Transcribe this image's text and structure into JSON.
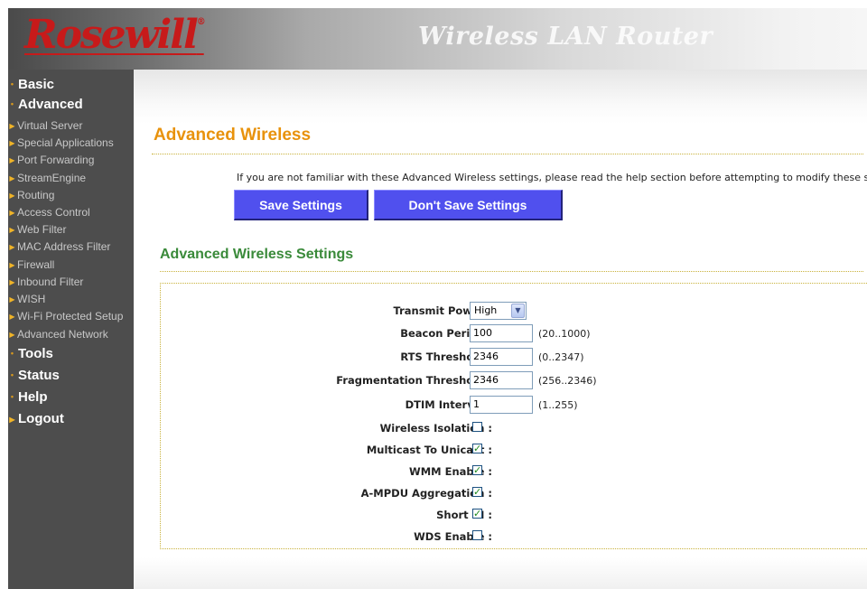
{
  "header": {
    "logo_text": "Rosewill",
    "logo_mark": "®",
    "product_title": "Wireless LAN Router"
  },
  "sidebar": {
    "items": [
      {
        "label": "Basic",
        "type": "main",
        "marker": "bullet"
      },
      {
        "label": "Advanced",
        "type": "main",
        "marker": "bullet"
      },
      {
        "label": "Virtual Server",
        "type": "sub",
        "marker": "arrow"
      },
      {
        "label": "Special Applications",
        "type": "sub",
        "marker": "arrow"
      },
      {
        "label": "Port Forwarding",
        "type": "sub",
        "marker": "arrow"
      },
      {
        "label": "StreamEngine",
        "type": "sub",
        "marker": "arrow"
      },
      {
        "label": "Routing",
        "type": "sub",
        "marker": "arrow"
      },
      {
        "label": "Access Control",
        "type": "sub",
        "marker": "arrow"
      },
      {
        "label": "Web Filter",
        "type": "sub",
        "marker": "arrow"
      },
      {
        "label": "MAC Address Filter",
        "type": "sub",
        "marker": "arrow"
      },
      {
        "label": "Firewall",
        "type": "sub",
        "marker": "arrow"
      },
      {
        "label": "Inbound Filter",
        "type": "sub",
        "marker": "arrow"
      },
      {
        "label": "WISH",
        "type": "sub",
        "marker": "arrow"
      },
      {
        "label": "Wi-Fi Protected Setup",
        "type": "sub",
        "marker": "arrow"
      },
      {
        "label": "Advanced Network",
        "type": "sub",
        "marker": "arrow"
      },
      {
        "label": "Tools",
        "type": "main",
        "marker": "bullet"
      },
      {
        "label": "Status",
        "type": "main",
        "marker": "bullet"
      },
      {
        "label": "Help",
        "type": "main",
        "marker": "bullet"
      },
      {
        "label": "Logout",
        "type": "main",
        "marker": "arrow"
      }
    ]
  },
  "main": {
    "page_title": "Advanced Wireless",
    "help_text": "If you are not familiar with these Advanced Wireless settings, please read the help section before attempting to modify these sett",
    "save_button": "Save Settings",
    "dont_save_button": "Don't Save Settings",
    "section_title": "Advanced Wireless Settings"
  },
  "settings": {
    "transmit_power": {
      "label": "Transmit Power :",
      "value": "High"
    },
    "beacon_period": {
      "label": "Beacon Period :",
      "value": "100",
      "range": "(20..1000)"
    },
    "rts_threshold": {
      "label": "RTS Threshold :",
      "value": "2346",
      "range": "(0..2347)"
    },
    "fragmentation_threshold": {
      "label": "Fragmentation Threshold :",
      "value": "2346",
      "range": "(256..2346)"
    },
    "dtim_interval": {
      "label": "DTIM Interval :",
      "value": "1",
      "range": "(1..255)"
    },
    "wireless_isolation": {
      "label": "Wireless Isolation :",
      "checked": false
    },
    "multicast_to_unicast": {
      "label": "Multicast To Unicast :",
      "checked": true
    },
    "wmm_enable": {
      "label": "WMM Enable :",
      "checked": true
    },
    "ampdu_aggregation": {
      "label": "A-MPDU Aggregation :",
      "checked": true
    },
    "short_gi": {
      "label": "Short GI :",
      "checked": true
    },
    "wds_enable": {
      "label": "WDS Enable :",
      "checked": false
    }
  },
  "colors": {
    "sidebar_bg": "#4d4d4d",
    "page_title": "#e8920c",
    "section_title": "#3a8a3a",
    "button_bg": "#5050ee",
    "logo": "#c71a1a",
    "check_mark": "#1f8a1f"
  },
  "icons": {
    "bullet": "bullet-icon",
    "arrow": "arrow-right-icon",
    "dropdown": "chevron-down-icon",
    "check": "checkmark-icon"
  }
}
